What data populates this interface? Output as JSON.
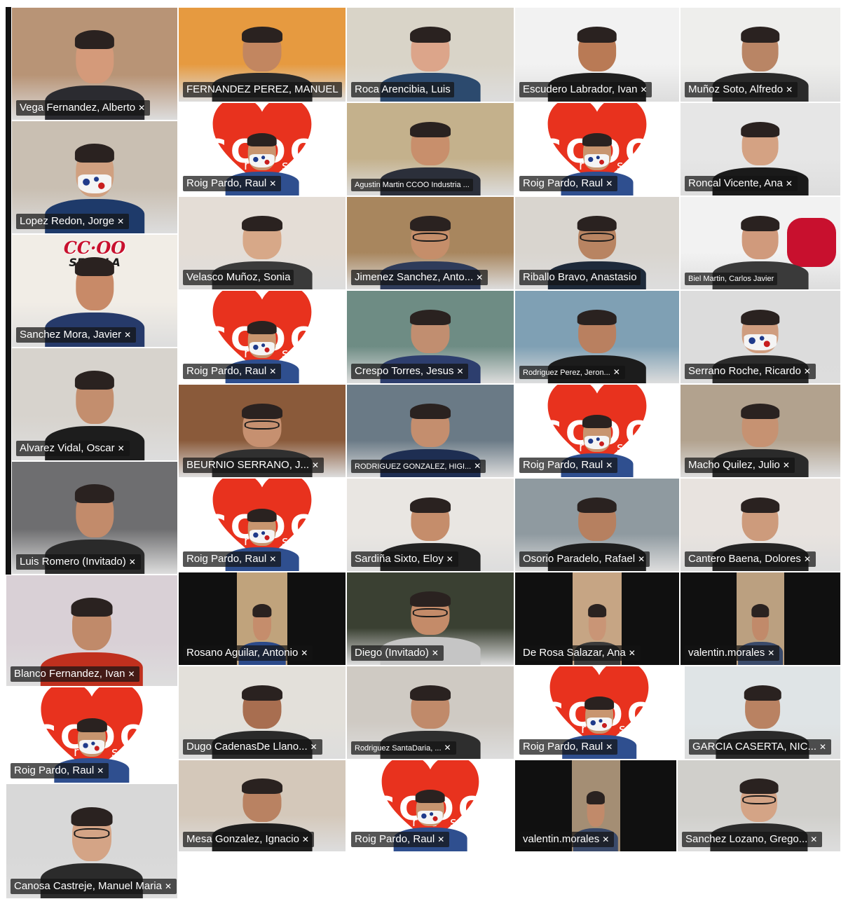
{
  "app": {
    "name": "Video conference gallery view"
  },
  "brand": {
    "ccoo_red": "#e8321e",
    "ccoo_heart": "#e8321e",
    "ccoo_text": "CCOO",
    "ccoo_sub": "enresa"
  },
  "overlays": {
    "sevilla_banner": "CC·OO",
    "sevilla_sub": "SEVILLA"
  },
  "mic_icon": "microphone-muted-icon",
  "participants": [
    {
      "name": "Vega Fernandez, Alberto",
      "muted": true,
      "type": "person",
      "bg": "#b89476",
      "skin": "#d49a7a",
      "shirt": "#2b2b30"
    },
    {
      "name": "FERNANDEZ PEREZ, MANUEL",
      "muted": false,
      "type": "person",
      "bg": "#e69a40",
      "skin": "#c28660",
      "shirt": "#2a2a2a"
    },
    {
      "name": "Roca Arencibia, Luis",
      "muted": false,
      "type": "person",
      "bg": "#d9d4c8",
      "skin": "#dca58a",
      "shirt": "#2c4a6e"
    },
    {
      "name": "Escudero Labrador, Ivan",
      "muted": true,
      "type": "person",
      "bg": "#f2f2f2",
      "skin": "#b97a55",
      "shirt": "#1e1e1e"
    },
    {
      "name": "Muñoz Soto, Alfredo",
      "muted": true,
      "type": "person",
      "bg": "#eeeeec",
      "skin": "#b98565",
      "shirt": "#2a2a2a"
    },
    {
      "name": "Lopez Redon, Jorge",
      "muted": true,
      "type": "mask",
      "bg": "#c9bfb2",
      "skin": "#d0a080",
      "shirt": "#1e3a6a"
    },
    {
      "name": "Roig Pardo, Raul",
      "muted": true,
      "type": "ccoo"
    },
    {
      "name": "Agustin Martin CCOO Industria ...",
      "muted": false,
      "type": "person",
      "bg": "#c4b18c",
      "skin": "#c88f6c",
      "shirt": "#2b2f3a"
    },
    {
      "name": "Roig Pardo, Raul",
      "muted": true,
      "type": "ccoo"
    },
    {
      "name": "Roncal Vicente, Ana",
      "muted": true,
      "type": "person",
      "bg": "#e6e6e6",
      "skin": "#d4a283",
      "shirt": "#1a1a1a"
    },
    {
      "name": "Sanchez Mora, Javier",
      "muted": true,
      "type": "sevilla",
      "bg": "#f1ede6",
      "skin": "#c88a68",
      "shirt": "#263a6a"
    },
    {
      "name": "Velasco Muñoz, Sonia",
      "muted": false,
      "type": "person",
      "bg": "#e4ddd6",
      "skin": "#d7a888",
      "shirt": "#3a3a3a"
    },
    {
      "name": "Jimenez Sanchez, Anto...",
      "muted": true,
      "type": "glasses",
      "bg": "#a8865e",
      "skin": "#c58e6a",
      "shirt": "#2e3b5a"
    },
    {
      "name": "Riballo Bravo, Anastasio",
      "muted": false,
      "type": "glasses",
      "bg": "#d9d5cf",
      "skin": "#b88462",
      "shirt": "#1e2a3a"
    },
    {
      "name": "Biel Martin, Carlos Javier",
      "muted": false,
      "type": "fist",
      "bg": "#f2f2f2",
      "skin": "#d09a7c",
      "shirt": "#3a3a3a"
    },
    {
      "name": "Alvarez Vidal, Oscar",
      "muted": true,
      "type": "person",
      "bg": "#d7d3cd",
      "skin": "#c38e6e",
      "shirt": "#1d1d1d"
    },
    {
      "name": "Roig Pardo, Raul",
      "muted": true,
      "type": "ccoo"
    },
    {
      "name": "Crespo Torres, Jesus",
      "muted": true,
      "type": "person",
      "bg": "#6e8c84",
      "skin": "#c18e70",
      "shirt": "#2d3e6e"
    },
    {
      "name": "Rodriguez Perez, Jeron...",
      "muted": true,
      "type": "person",
      "bg": "#7fa0b4",
      "skin": "#b98060",
      "shirt": "#1c1c1c"
    },
    {
      "name": "Serrano Roche, Ricardo",
      "muted": true,
      "type": "mask",
      "bg": "#dcdcdc",
      "skin": "#cf9d7f",
      "shirt": "#2b2b2b"
    },
    {
      "name": "Luis Romero (Invitado)",
      "muted": true,
      "type": "person",
      "bg": "#6e6e70",
      "skin": "#c28b6b",
      "shirt": "#2a2a2a"
    },
    {
      "name": "BEURNIO SERRANO, J...",
      "muted": true,
      "type": "glasses",
      "bg": "#8a5a3a",
      "skin": "#c69070",
      "shirt": "#303030"
    },
    {
      "name": "RODRIGUEZ GONZALEZ, HIGI...",
      "muted": true,
      "type": "person",
      "bg": "#6a7a86",
      "skin": "#c48e6e",
      "shirt": "#1e2e52"
    },
    {
      "name": "Roig Pardo, Raul",
      "muted": true,
      "type": "ccoo"
    },
    {
      "name": "Macho Quilez, Julio",
      "muted": true,
      "type": "person",
      "bg": "#b2a28e",
      "skin": "#c69272",
      "shirt": "#2a2a2a"
    },
    {
      "name": "Blanco Fernandez, Ivan",
      "muted": true,
      "type": "person",
      "bg": "#d9d0d6",
      "skin": "#c08a6a",
      "shirt": "#c0301e"
    },
    {
      "name": "Roig Pardo, Raul",
      "muted": true,
      "type": "ccoo"
    },
    {
      "name": "Sardiña Sixto, Eloy",
      "muted": true,
      "type": "person",
      "bg": "#e9e6e2",
      "skin": "#c58d6b",
      "shirt": "#222222"
    },
    {
      "name": "Osorio Paradelo, Rafael",
      "muted": true,
      "type": "person",
      "bg": "#8f9aa0",
      "skin": "#b68060",
      "shirt": "#1e1e1e"
    },
    {
      "name": "Cantero Baena, Dolores",
      "muted": true,
      "type": "person",
      "bg": "#e8e3df",
      "skin": "#cd9b7c",
      "shirt": "#242424"
    },
    {
      "name": "Roig Pardo, Raul",
      "muted": true,
      "type": "ccoo"
    },
    {
      "name": "Rosano Aguilar, Antonio",
      "muted": true,
      "type": "darkframe",
      "bg": "#c0a37c",
      "skin": "#c58d6c",
      "shirt": "#2c4a8a"
    },
    {
      "name": "Diego (Invitado)",
      "muted": true,
      "type": "glasses",
      "bg": "#3a4032",
      "skin": "#c48b69",
      "shirt": "#c5c5c5"
    },
    {
      "name": "De Rosa Salazar, Ana",
      "muted": true,
      "type": "darkframe",
      "bg": "#c6a584",
      "skin": "#c99576",
      "shirt": "#3a3a3a"
    },
    {
      "name": "valentin.morales",
      "muted": true,
      "type": "darkframe",
      "bg": "#bba080",
      "skin": "#c18a6a",
      "shirt": "#3a4a6a"
    },
    {
      "name": "Canosa Castreje, Manuel Maria",
      "muted": true,
      "type": "glasses",
      "bg": "#d8d8d8",
      "skin": "#d4a486",
      "shirt": "#2b2b2b"
    },
    {
      "name": "Dugo CadenasDe Llano...",
      "muted": true,
      "type": "person",
      "bg": "#e3e0da",
      "skin": "#a86e50",
      "shirt": "#2a2a2a"
    },
    {
      "name": "Rodriguez SantaDaria, ...",
      "muted": true,
      "type": "person",
      "bg": "#cfcac3",
      "skin": "#c08a6a",
      "shirt": "#2e2e2e"
    },
    {
      "name": "Roig Pardo, Raul",
      "muted": true,
      "type": "ccoo"
    },
    {
      "name": "GARCIA CASERTA, NIC...",
      "muted": true,
      "type": "person",
      "bg": "#dfe4e6",
      "skin": "#b98262",
      "shirt": "#2a2a2a"
    },
    {
      "name": "Mesa Gonzalez, Ignacio",
      "muted": true,
      "type": "person",
      "bg": "#d4c8ba",
      "skin": "#b98262",
      "shirt": "#1e1e1e"
    },
    {
      "name": "Roig Pardo, Raul",
      "muted": true,
      "type": "ccoo"
    },
    {
      "name": "valentin.morales",
      "muted": true,
      "type": "darkframe",
      "bg": "#a48e74",
      "skin": "#c18a6a",
      "shirt": "#3a4a6a"
    },
    {
      "name": "Sanchez Lozano, Grego...",
      "muted": true,
      "type": "glasses",
      "bg": "#d0cfcb",
      "skin": "#d4a486",
      "shirt": "#2b2b2b"
    }
  ]
}
